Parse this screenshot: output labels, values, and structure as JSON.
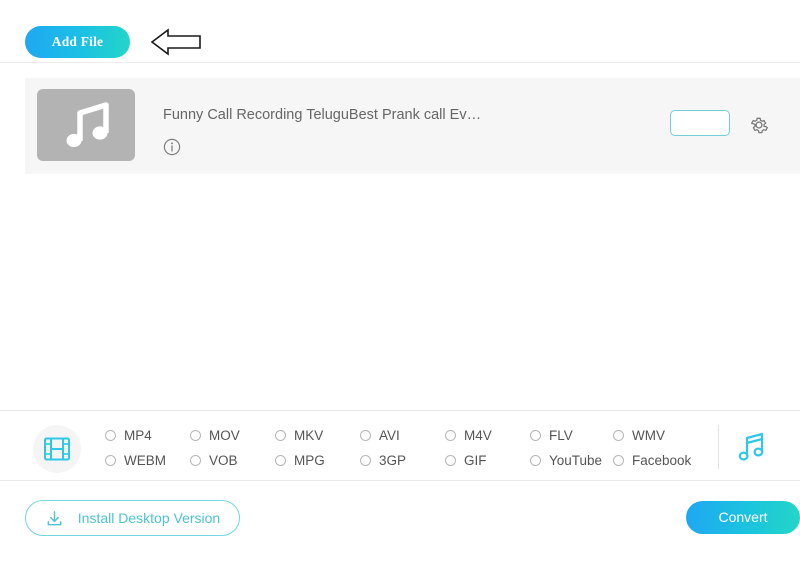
{
  "toolbar": {
    "add_file_label": "Add File",
    "arrow_hint_icon": "left-arrow-annotation"
  },
  "file_list": {
    "files": [
      {
        "title": "Funny Call Recording TeluguBest Prank call Ev…",
        "thumbnail_icon": "music-note-icon",
        "info_icon": "info-circle-icon",
        "progress_value": "",
        "settings_icon": "gear-icon"
      }
    ]
  },
  "format_bar": {
    "video_type_icon": "film-strip-icon",
    "audio_type_icon": "music-note-icon",
    "columns": [
      {
        "top": "MP4",
        "bottom": "WEBM"
      },
      {
        "top": "MOV",
        "bottom": "VOB"
      },
      {
        "top": "MKV",
        "bottom": "MPG"
      },
      {
        "top": "AVI",
        "bottom": "3GP"
      },
      {
        "top": "M4V",
        "bottom": "GIF"
      },
      {
        "top": "FLV",
        "bottom": "YouTube"
      },
      {
        "top": "WMV",
        "bottom": "Facebook"
      }
    ]
  },
  "bottom_bar": {
    "install_label": "Install Desktop Version",
    "install_icon": "download-icon",
    "convert_label": "Convert"
  },
  "colors": {
    "accent_blue": "#1fa7f2",
    "accent_teal": "#23d6c7",
    "outline_teal": "#74d6e0",
    "row_background": "#f6f6f6",
    "thumbnail_gray": "#b3b3b3",
    "text_gray": "#666666"
  }
}
